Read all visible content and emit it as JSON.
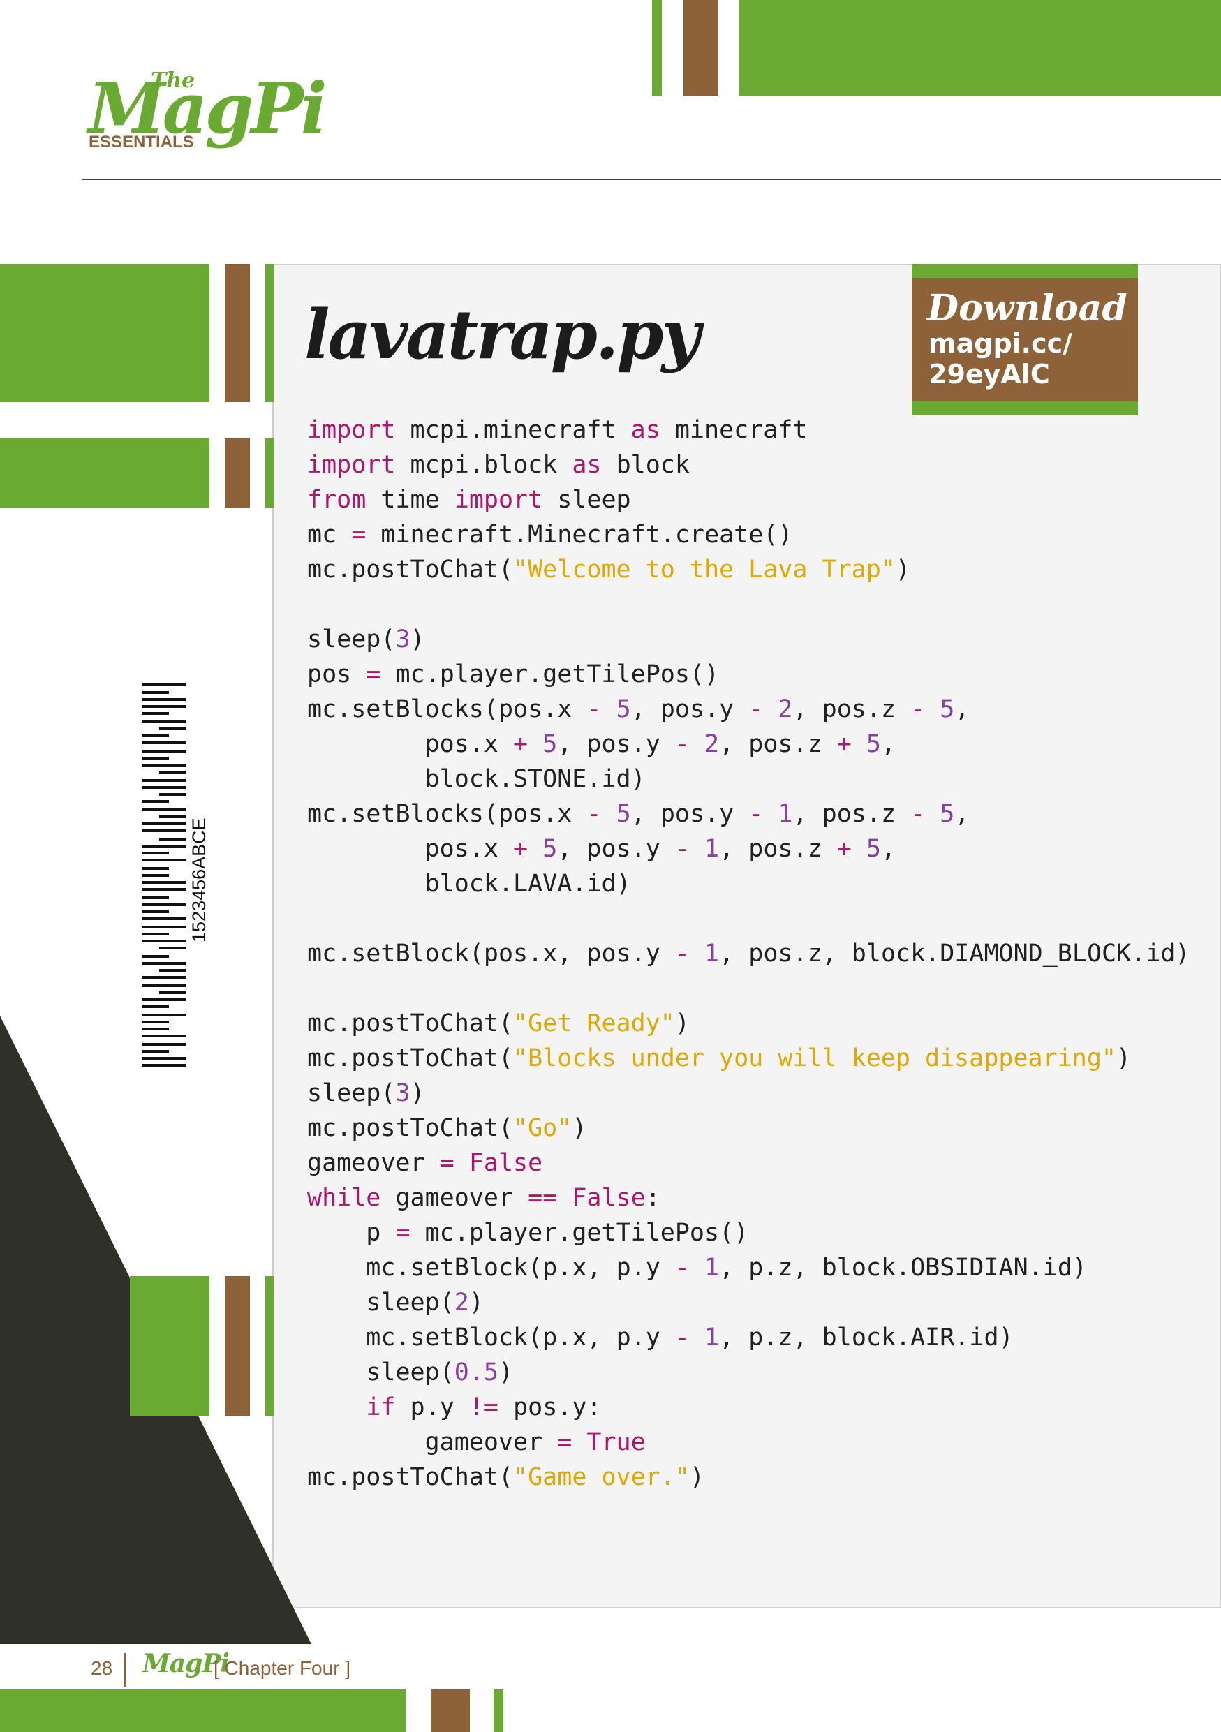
{
  "header": {
    "logo_the": "The",
    "logo_name": "MagPi",
    "logo_sub": "ESSENTIALS"
  },
  "listing": {
    "title": "lavatrap.py",
    "download_heading": "Download",
    "download_url_1": "magpi.cc/",
    "download_url_2": "29eyAlC"
  },
  "code_lines": [
    "import mcpi.minecraft as minecraft",
    "import mcpi.block as block",
    "from time import sleep",
    "mc = minecraft.Minecraft.create()",
    "mc.postToChat(\"Welcome to the Lava Trap\")",
    "",
    "sleep(3)",
    "pos = mc.player.getTilePos()",
    "mc.setBlocks(pos.x - 5, pos.y - 2, pos.z - 5,",
    "        pos.x + 5, pos.y - 2, pos.z + 5,",
    "        block.STONE.id)",
    "mc.setBlocks(pos.x - 5, pos.y - 1, pos.z - 5,",
    "        pos.x + 5, pos.y - 1, pos.z + 5,",
    "        block.LAVA.id)",
    "",
    "mc.setBlock(pos.x, pos.y - 1, pos.z, block.DIAMOND_BLOCK.id)",
    "",
    "mc.postToChat(\"Get Ready\")",
    "mc.postToChat(\"Blocks under you will keep disappearing\")",
    "sleep(3)",
    "mc.postToChat(\"Go\")",
    "gameover = False",
    "while gameover == False:",
    "    p = mc.player.getTilePos()",
    "    mc.setBlock(p.x, p.y - 1, p.z, block.OBSIDIAN.id)",
    "    sleep(2)",
    "    mc.setBlock(p.x, p.y - 1, p.z, block.AIR.id)",
    "    sleep(0.5)",
    "    if p.y != pos.y:",
    "        gameover = True",
    "mc.postToChat(\"Game over.\")"
  ],
  "barcode": {
    "number": "1523456ABCE"
  },
  "footer": {
    "page_number": "28",
    "logo": "MagPi",
    "chapter": "[ Chapter Four ]"
  },
  "colors": {
    "green": "#6aaa33",
    "brown": "#8e6239",
    "dark": "#2f3029",
    "keyword": "#b4136b",
    "string": "#e0a800",
    "number": "#8a3ea8"
  }
}
